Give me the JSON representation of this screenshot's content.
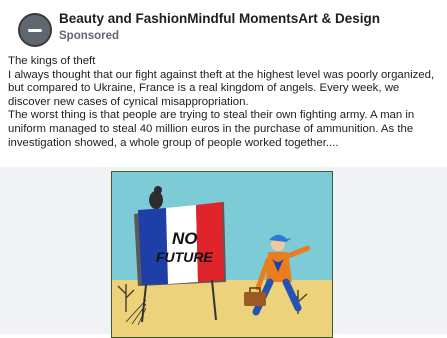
{
  "post": {
    "page_name": "Beauty and FashionMindful MomentsArt & Design",
    "sponsored_label": "Sponsored",
    "avatar_icon": "minus-circle-icon",
    "text": {
      "line_1": "The kings of theft",
      "paragraph_1": "I always thought that our fight against theft at the highest level was poorly organized, but compared to Ukraine, France is a real kingdom of angels. Every week, we discover new cases of cynical misappropriation.",
      "paragraph_2": "The worst thing is that people are trying to steal their own fighting army. A man in uniform managed to steal 40 million euros in the purchase of ammunition. As the investigation showed, a whole group of people worked together...."
    },
    "image": {
      "sign_text_1": "NO",
      "sign_text_2": "FUTURE"
    }
  }
}
